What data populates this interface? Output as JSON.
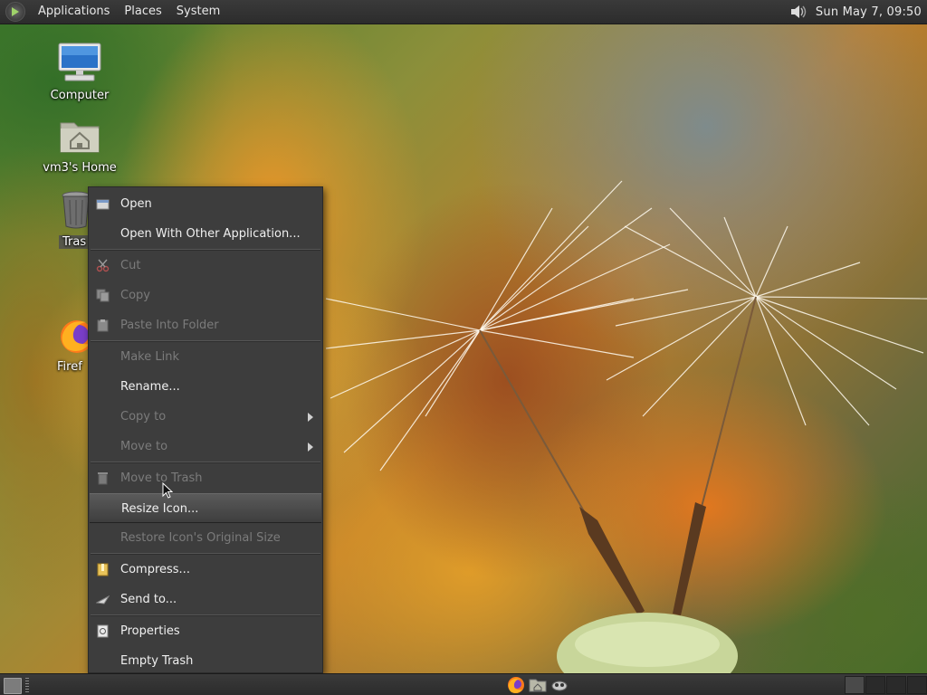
{
  "top_panel": {
    "menus": [
      "Applications",
      "Places",
      "System"
    ],
    "clock": "Sun May  7, 09:50",
    "volume_icon": "speaker-icon"
  },
  "desktop_icons": [
    {
      "label": "Computer",
      "icon": "computer-icon"
    },
    {
      "label": "vm3's Home",
      "icon": "home-folder-icon"
    },
    {
      "label": "Trash",
      "icon": "trash-icon",
      "visible_label": "Tras"
    },
    {
      "label": "Firefox",
      "icon": "firefox-icon",
      "visible_label": "Firef"
    }
  ],
  "context_menu": {
    "items": [
      {
        "label": "Open",
        "icon": "open-icon",
        "enabled": true
      },
      {
        "label": "Open With Other Application...",
        "enabled": true
      },
      {
        "label": "Cut",
        "icon": "scissors-icon",
        "enabled": false
      },
      {
        "label": "Copy",
        "icon": "copy-icon",
        "enabled": false
      },
      {
        "label": "Paste Into Folder",
        "icon": "paste-icon",
        "enabled": false
      },
      {
        "label": "Make Link",
        "enabled": false
      },
      {
        "label": "Rename...",
        "enabled": true
      },
      {
        "label": "Copy to",
        "enabled": false,
        "submenu": true
      },
      {
        "label": "Move to",
        "enabled": false,
        "submenu": true
      },
      {
        "label": "Move to Trash",
        "icon": "trash-small-icon",
        "enabled": false
      },
      {
        "label": "Resize Icon...",
        "enabled": true,
        "highlighted": true
      },
      {
        "label": "Restore Icon's Original Size",
        "enabled": false
      },
      {
        "label": "Compress...",
        "icon": "archive-icon",
        "enabled": true
      },
      {
        "label": "Send to...",
        "icon": "send-icon",
        "enabled": true
      },
      {
        "label": "Properties",
        "icon": "properties-icon",
        "enabled": true
      },
      {
        "label": "Empty Trash",
        "enabled": true
      }
    ]
  },
  "bottom_panel": {
    "launchers": [
      "firefox-icon",
      "file-manager-icon",
      "screenshot-icon"
    ],
    "workspaces": 4
  }
}
